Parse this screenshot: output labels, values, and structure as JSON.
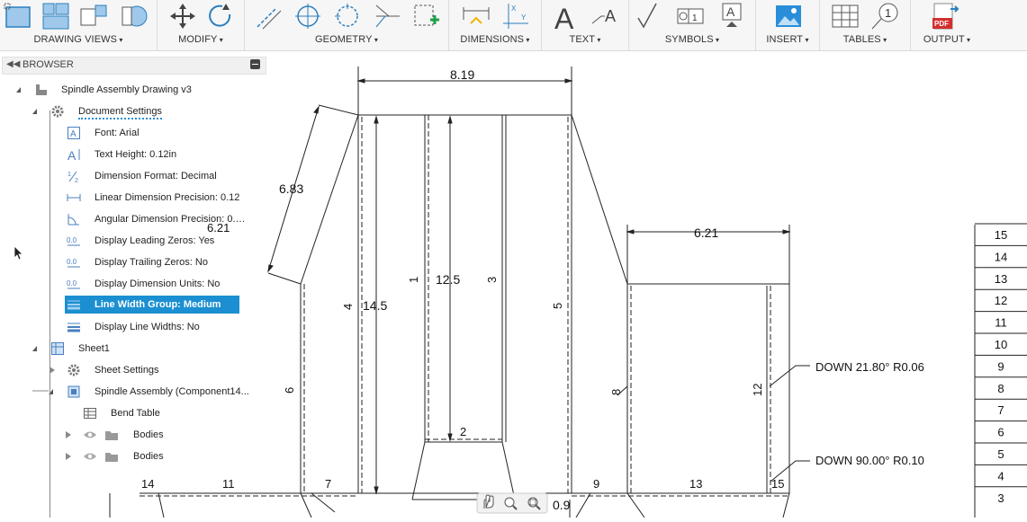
{
  "toolbar": {
    "groups": [
      {
        "label": "DRAWING VIEWS"
      },
      {
        "label": "MODIFY"
      },
      {
        "label": "GEOMETRY"
      },
      {
        "label": "DIMENSIONS"
      },
      {
        "label": "TEXT"
      },
      {
        "label": "SYMBOLS"
      },
      {
        "label": "INSERT"
      },
      {
        "label": "TABLES"
      },
      {
        "label": "OUTPUT"
      }
    ],
    "text_icon_glyph": "A",
    "pdf_badge": "PDF",
    "balloon_number": "1",
    "accent_color": "#1b8fd1"
  },
  "browser": {
    "title": "BROWSER",
    "root": "Spindle Assembly Drawing v3",
    "document_settings": "Document Settings",
    "settings": [
      {
        "label": "Font: Arial",
        "icon": "font-icon"
      },
      {
        "label": "Text Height: 0.12in",
        "icon": "text-height-icon"
      },
      {
        "label": "Dimension Format: Decimal",
        "icon": "fraction-icon"
      },
      {
        "label": "Linear Dimension Precision: 0.12",
        "icon": "linear-dimension-icon"
      },
      {
        "label": "Angular Dimension Precision: 0.…",
        "icon": "angular-dimension-icon"
      },
      {
        "label": "Display Leading Zeros: Yes",
        "icon": "zeros-icon"
      },
      {
        "label": "Display Trailing Zeros: No",
        "icon": "zeros-icon"
      },
      {
        "label": "Display Dimension Units: No",
        "icon": "zeros-icon"
      },
      {
        "label": "Line Width Group: Medium",
        "icon": "line-width-icon"
      },
      {
        "label": "Display Line Widths: No",
        "icon": "line-width-icon"
      }
    ],
    "sheet": "Sheet1",
    "sheet_settings": "Sheet Settings",
    "component": "Spindle Assembly (Component14...",
    "bend_table": "Bend Table",
    "bodies": [
      "Bodies",
      "Bodies"
    ]
  },
  "drawing": {
    "dims": {
      "top_width": "8.19",
      "slant": "6.83",
      "right_width": "6.21",
      "height_outer": "14.5",
      "height_inner": "12.5",
      "small_bottom": "0.9",
      "partial_left": "6.21"
    },
    "bend_labels": [
      "1",
      "2",
      "3",
      "4",
      "5",
      "6",
      "7",
      "8",
      "9",
      "11",
      "12",
      "13",
      "14",
      "15"
    ],
    "notes": [
      "DOWN 21.80° R0.06",
      "DOWN 90.00° R0.10"
    ],
    "bend_table_rows": [
      "15",
      "14",
      "13",
      "12",
      "11",
      "10",
      "9",
      "8",
      "7",
      "6",
      "5",
      "4",
      "3"
    ]
  }
}
